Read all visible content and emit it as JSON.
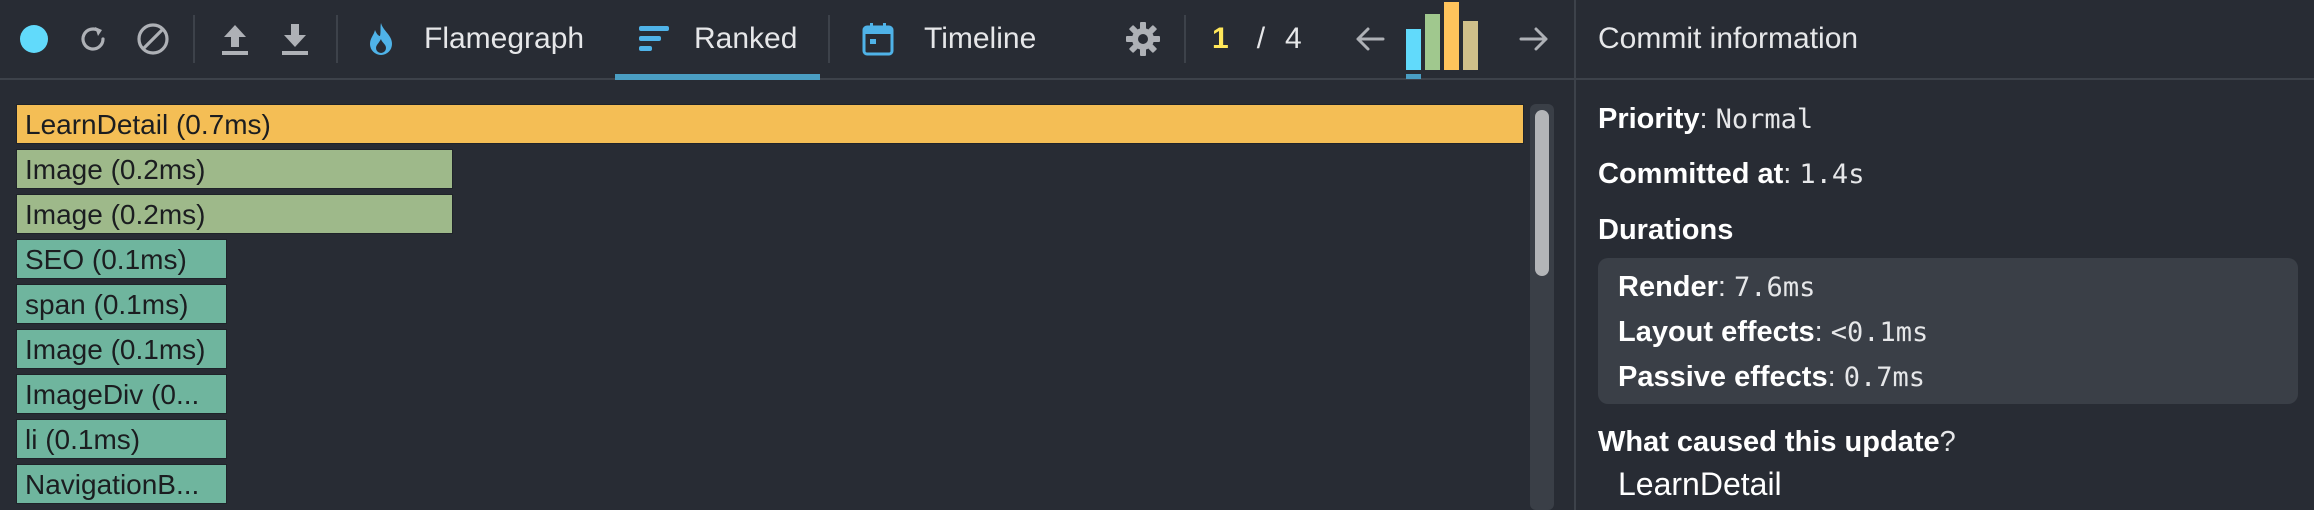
{
  "toolbar": {
    "tabs": [
      {
        "label": "Flamegraph",
        "icon": "flame-icon"
      },
      {
        "label": "Ranked",
        "icon": "ranked-icon",
        "selected": true
      },
      {
        "label": "Timeline",
        "icon": "calendar-icon"
      }
    ],
    "commit_nav": {
      "current": "1",
      "separator": "/",
      "total": "4"
    },
    "commit_bars": [
      {
        "level": 0.6,
        "color": "#61dafb",
        "selected": true
      },
      {
        "level": 0.82,
        "color": "#a0c88e"
      },
      {
        "level": 1.0,
        "color": "#ffc45c"
      },
      {
        "level": 0.72,
        "color": "#d0c08a"
      }
    ],
    "colors": {
      "accent": "#4a9ec3",
      "record": "#61dafb",
      "flame": "#4fb3e8"
    }
  },
  "ranked": {
    "rows": [
      {
        "label": "LearnDetail (0.7ms)",
        "fraction": 1.0,
        "color": "#f4be55"
      },
      {
        "label": "Image (0.2ms)",
        "fraction": 0.29,
        "color": "#9eb98a"
      },
      {
        "label": "Image (0.2ms)",
        "fraction": 0.29,
        "color": "#9eb98a"
      },
      {
        "label": "SEO (0.1ms)",
        "fraction": 0.14,
        "color": "#6fb59e"
      },
      {
        "label": "span (0.1ms)",
        "fraction": 0.14,
        "color": "#6fb59e"
      },
      {
        "label": "Image (0.1ms)",
        "fraction": 0.14,
        "color": "#6fb59e"
      },
      {
        "label": "ImageDiv (0...",
        "fraction": 0.14,
        "color": "#6fb59e"
      },
      {
        "label": "li (0.1ms)",
        "fraction": 0.14,
        "color": "#6fb59e"
      },
      {
        "label": "NavigationB...",
        "fraction": 0.14,
        "color": "#6fb59e"
      }
    ]
  },
  "commit_info": {
    "title": "Commit information",
    "priority_label": "Priority",
    "priority_value": "Normal",
    "committed_label": "Committed at",
    "committed_value": "1.4s",
    "durations_label": "Durations",
    "render_label": "Render",
    "render_value": "7.6ms",
    "layout_label": "Layout effects",
    "layout_value": "<0.1ms",
    "passive_label": "Passive effects",
    "passive_value": "0.7ms",
    "cause_label": "What caused this update",
    "cause_q": "?",
    "cause_item": "LearnDetail"
  }
}
